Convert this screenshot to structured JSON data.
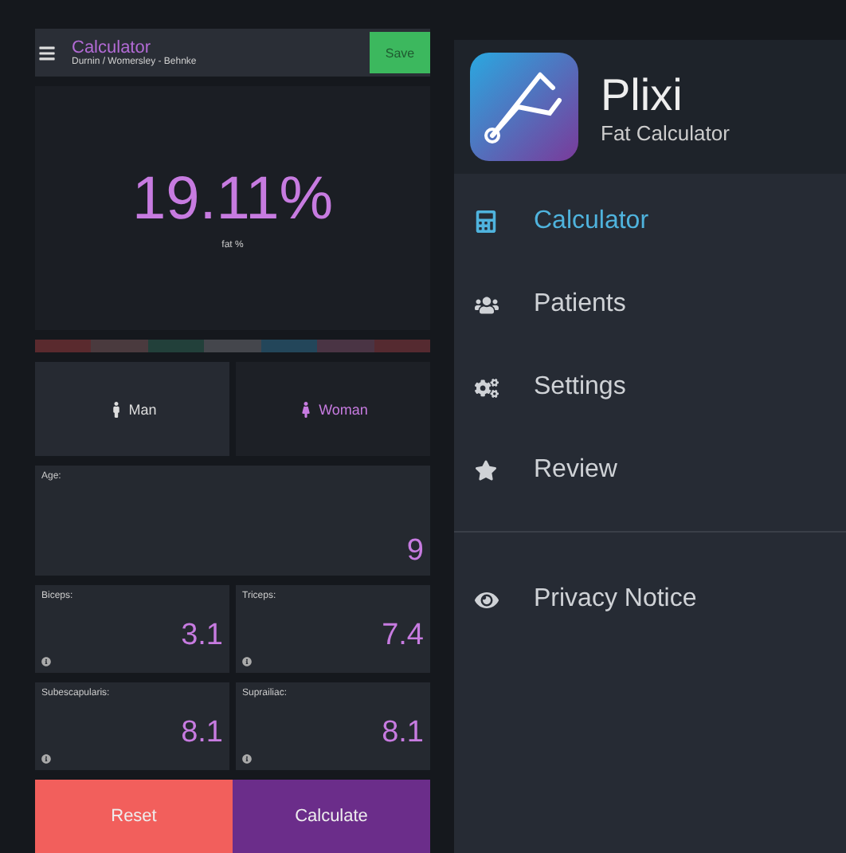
{
  "header": {
    "title": "Calculator",
    "subtitle": "Durnin / Womersley - Behnke",
    "save_label": "Save"
  },
  "result": {
    "value": "19.11%",
    "label": "fat %"
  },
  "scale": [
    {
      "color": "#5a2a2e"
    },
    {
      "color": "#4a3a3e"
    },
    {
      "color": "#22403a"
    },
    {
      "color": "#44464c"
    },
    {
      "color": "#23465a"
    },
    {
      "color": "#4a3444"
    },
    {
      "color": "#552a30"
    }
  ],
  "gender": [
    {
      "label": "Man",
      "kind": "man",
      "selected": false
    },
    {
      "label": "Woman",
      "kind": "woman",
      "selected": true
    }
  ],
  "age": {
    "label": "Age:",
    "value": "9"
  },
  "measurements": [
    {
      "label": "Biceps:",
      "value": "3.1"
    },
    {
      "label": "Triceps:",
      "value": "7.4"
    },
    {
      "label": "Subescapularis:",
      "value": "8.1"
    },
    {
      "label": "Suprailiac:",
      "value": "8.1"
    }
  ],
  "actions": [
    {
      "label": "Reset",
      "kind": "reset"
    },
    {
      "label": "Calculate",
      "kind": "calculate"
    }
  ],
  "drawer": {
    "app_name": "Plixi",
    "app_subtitle": "Fat Calculator",
    "items": [
      {
        "label": "Calculator",
        "kind": "calculator",
        "selected": true
      },
      {
        "label": "Patients",
        "kind": "users",
        "selected": false
      },
      {
        "label": "Settings",
        "kind": "cogs",
        "selected": false
      },
      {
        "label": "Review",
        "kind": "star",
        "selected": false
      }
    ],
    "footer_items": [
      {
        "label": "Privacy Notice",
        "kind": "eye",
        "selected": false
      }
    ]
  }
}
